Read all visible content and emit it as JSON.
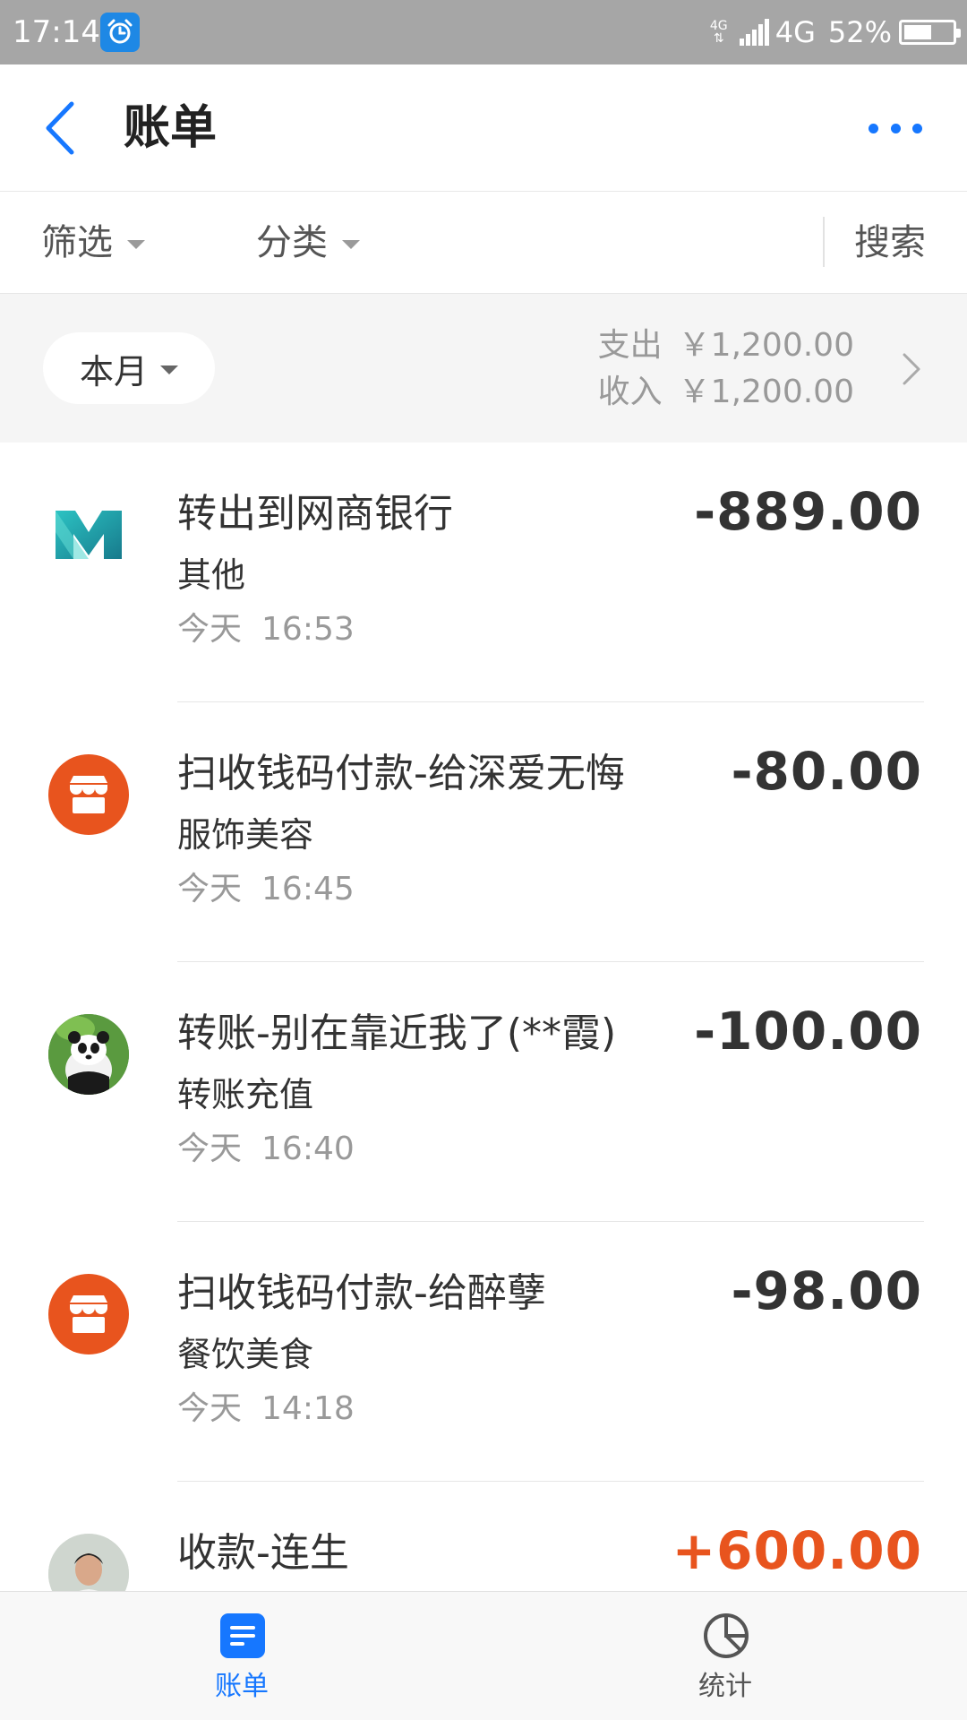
{
  "status_bar": {
    "time": "17:14",
    "network_small": "4G",
    "network": "4G",
    "battery_percent": "52%",
    "battery_level": 0.52
  },
  "header": {
    "title": "账单"
  },
  "filter_bar": {
    "filter_label": "筛选",
    "category_label": "分类",
    "search_label": "搜索"
  },
  "summary": {
    "month_label": "本月",
    "expense_label": "支出",
    "expense_value": "￥1,200.00",
    "income_label": "收入",
    "income_value": "￥1,200.00"
  },
  "transactions": [
    {
      "title": "转出到网商银行",
      "category": "其他",
      "day": "今天",
      "time": "16:53",
      "amount": "-889.00",
      "icon": "mybank-logo-icon"
    },
    {
      "title": "扫收钱码付款-给深爱无悔",
      "category": "服饰美容",
      "day": "今天",
      "time": "16:45",
      "amount": "-80.00",
      "icon": "shop-icon"
    },
    {
      "title": "转账-别在靠近我了(**霞)",
      "category": "转账充值",
      "day": "今天",
      "time": "16:40",
      "amount": "-100.00",
      "icon": "panda-avatar"
    },
    {
      "title": "扫收钱码付款-给醉孽",
      "category": "餐饮美食",
      "day": "今天",
      "time": "14:18",
      "amount": "-98.00",
      "icon": "shop-icon"
    },
    {
      "title": "收款-连生",
      "category": "",
      "day": "",
      "time": "",
      "amount": "+600.00",
      "icon": "person-avatar"
    }
  ],
  "tab_bar": {
    "bill_label": "账单",
    "stats_label": "统计"
  },
  "colors": {
    "accent": "#1677ff",
    "income": "#e8541e",
    "shop_icon": "#e8541e",
    "status_bar": "#a6a6a6"
  }
}
